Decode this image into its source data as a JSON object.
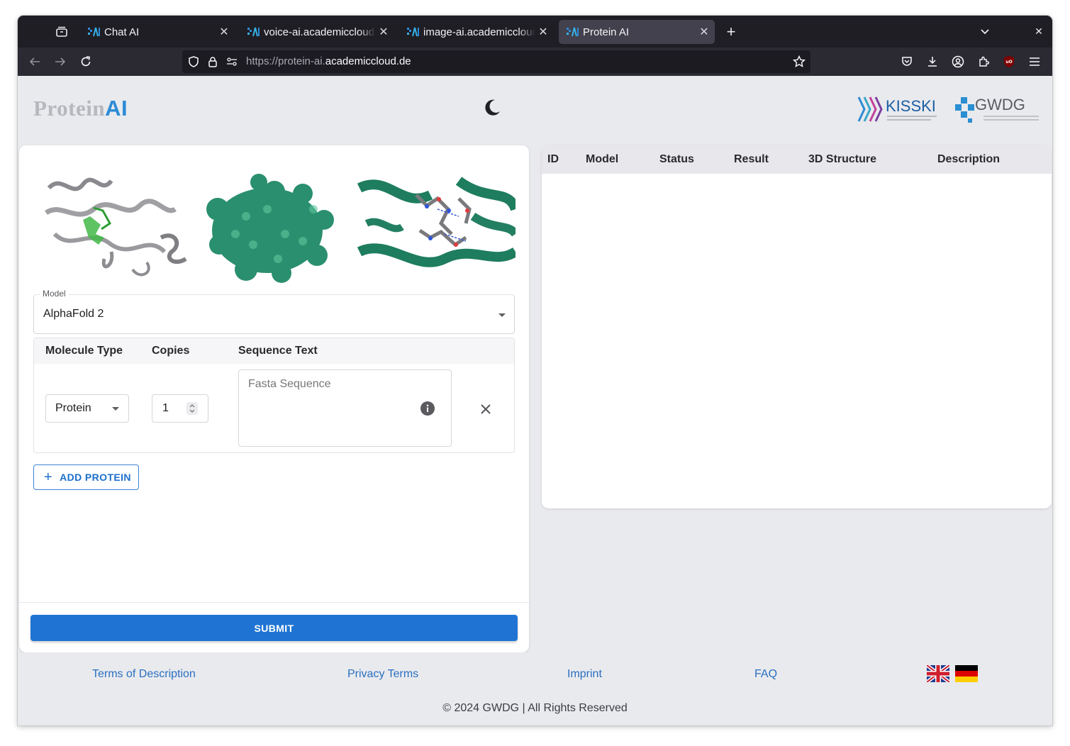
{
  "browser": {
    "tabs": [
      {
        "title": "Chat AI"
      },
      {
        "title": "voice-ai.academiccloud.de"
      },
      {
        "title": "image-ai.academiccloud.de"
      },
      {
        "title": "Protein AI"
      }
    ],
    "url_prefix": "https://protein-ai.",
    "url_domain": "academiccloud.de"
  },
  "header": {
    "logo_text": "Protein",
    "logo_ai": "AI",
    "partners": [
      "KISSKI",
      "GWDG"
    ]
  },
  "form": {
    "model_label": "Model",
    "model_value": "AlphaFold 2",
    "columns": [
      "Molecule Type",
      "Copies",
      "Sequence Text"
    ],
    "row": {
      "molecule_type": "Protein",
      "copies": "1",
      "sequence_placeholder": "Fasta Sequence"
    },
    "add_button": "ADD PROTEIN",
    "submit_button": "SUBMIT"
  },
  "results": {
    "columns": [
      "ID",
      "Model",
      "Status",
      "Result",
      "3D Structure",
      "Description"
    ]
  },
  "footer": {
    "links": [
      "Terms of Description",
      "Privacy Terms",
      "Imprint",
      "FAQ"
    ],
    "copyright": "© 2024 GWDG | All Rights Reserved"
  },
  "colors": {
    "accent": "#1f74d3",
    "protein_green": "#2a8f6e",
    "link": "#2a6fbf"
  }
}
